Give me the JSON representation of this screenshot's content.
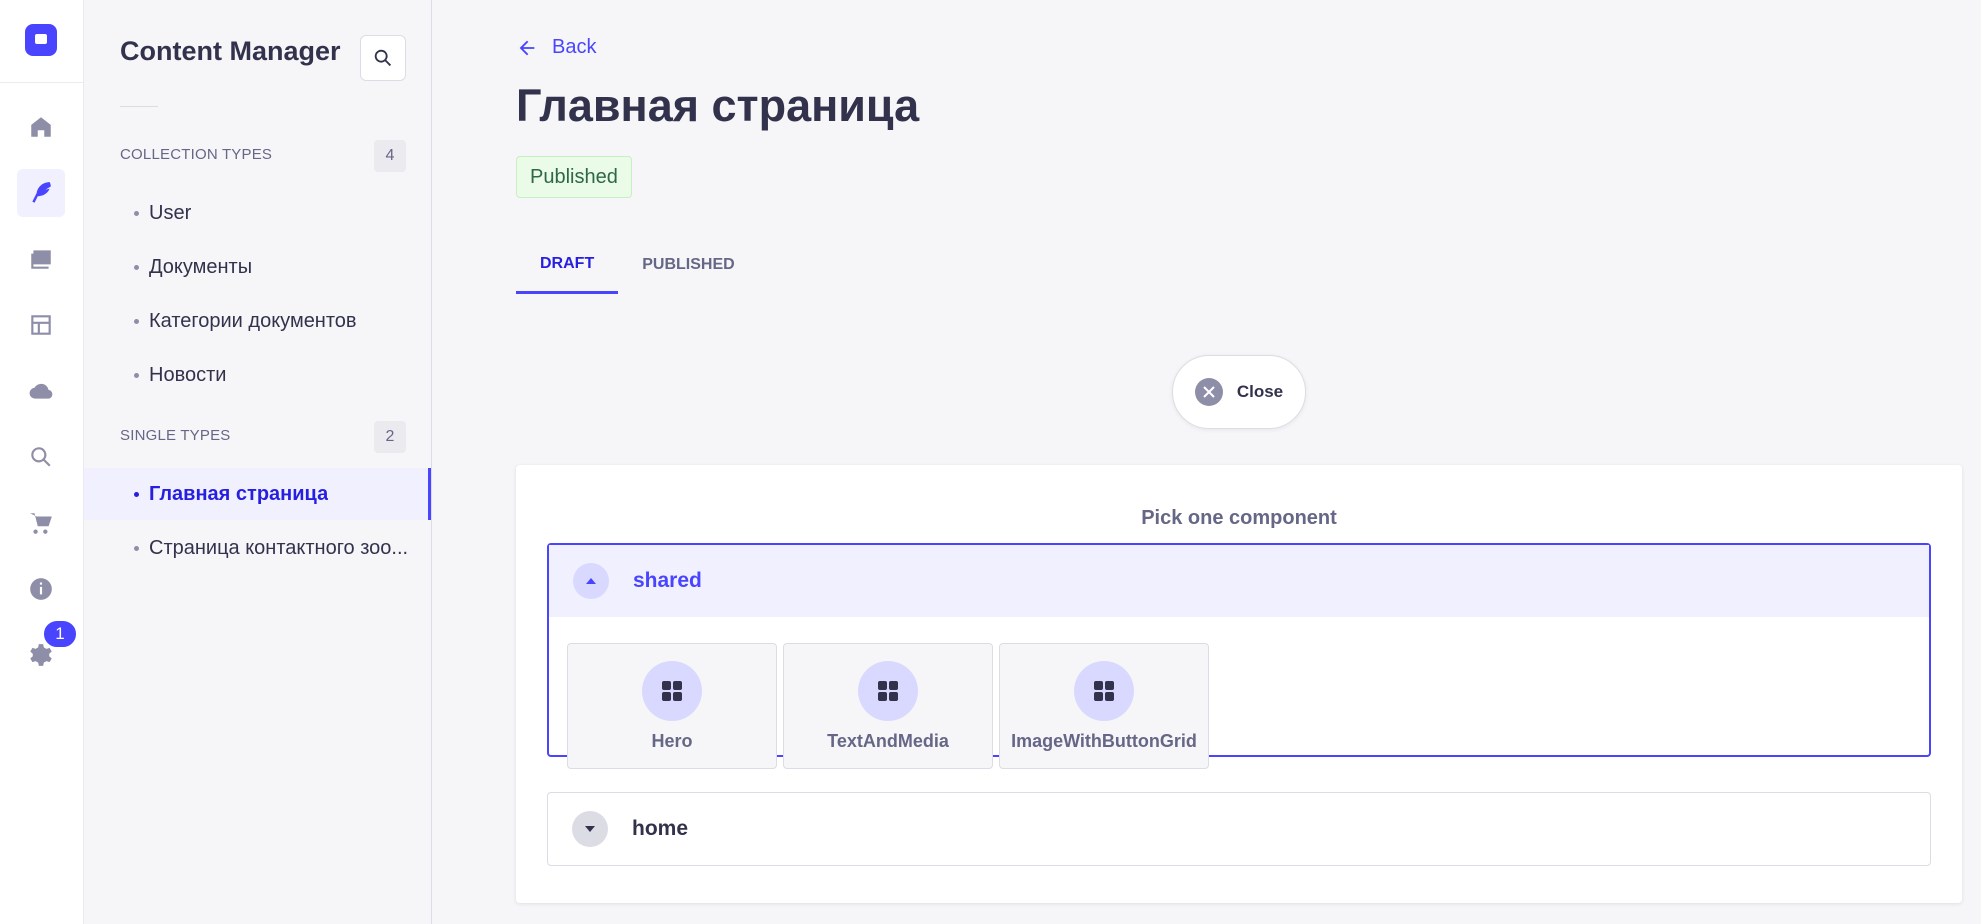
{
  "colors": {
    "accent": "#4945ff",
    "accent_dark": "#271fe0",
    "accent_light": "#f0f0ff",
    "success_bg": "#eafbe7",
    "success_text": "#2f6846"
  },
  "rail": {
    "icons": [
      "logo-icon",
      "home-icon",
      "content-manager-icon",
      "media-library-icon",
      "layout-icon",
      "cloud-icon",
      "search-icon",
      "cart-icon",
      "info-icon",
      "settings-icon"
    ],
    "settings_badge": "1"
  },
  "subnav": {
    "title": "Content Manager",
    "collection_types": {
      "label": "COLLECTION TYPES",
      "count": "4",
      "items": [
        "User",
        "Документы",
        "Категории документов",
        "Новости"
      ]
    },
    "single_types": {
      "label": "SINGLE TYPES",
      "count": "2",
      "items": [
        "Главная страница",
        "Страница контактного зоо..."
      ],
      "active_index": 0
    }
  },
  "main": {
    "back_label": "Back",
    "title": "Главная страница",
    "status": "Published",
    "tabs": [
      {
        "label": "DRAFT",
        "active": true
      },
      {
        "label": "PUBLISHED",
        "active": false
      }
    ],
    "close_label": "Close",
    "picker": {
      "heading": "Pick one component",
      "groups": [
        {
          "name": "shared",
          "expanded": true,
          "components": [
            "Hero",
            "TextAndMedia",
            "ImageWithButtonGrid"
          ]
        },
        {
          "name": "home",
          "expanded": false,
          "components": []
        }
      ]
    }
  }
}
